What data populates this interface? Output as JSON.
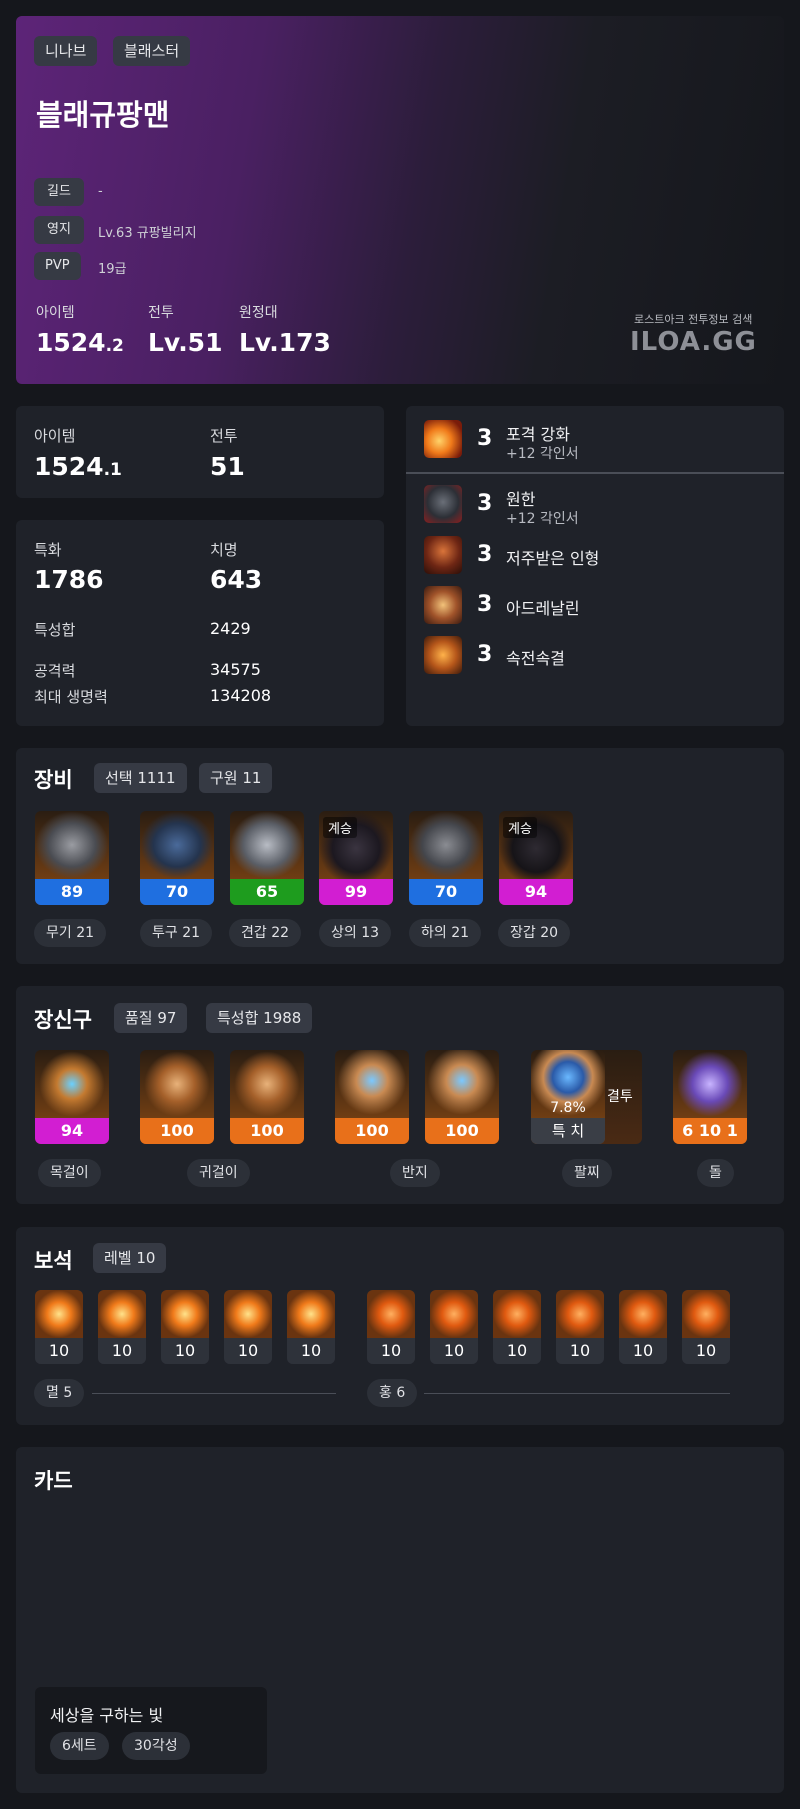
{
  "profile": {
    "server": "니나브",
    "class": "블래스터",
    "name": "블래규팡맨",
    "guild_label": "길드",
    "guild_value": "-",
    "estate_label": "영지",
    "estate_value": "Lv.63 규팡빌리지",
    "pvp_label": "PVP",
    "pvp_value": "19급",
    "item_label": "아이템",
    "item_main": "1524",
    "item_decimal": ".2",
    "combat_label": "전투",
    "combat_value": "Lv.51",
    "expedition_label": "원정대",
    "expedition_value": "Lv.173",
    "brand_caption": "로스트아크 전투정보 검색",
    "brand_logo": "ILOA.GG"
  },
  "levels": {
    "item_label": "아이템",
    "item_main": "1524",
    "item_decimal": ".1",
    "combat_label": "전투",
    "combat_value": "51"
  },
  "stats": {
    "spec_label": "특화",
    "spec_value": "1786",
    "crit_label": "치명",
    "crit_value": "643",
    "sum_label": "특성합",
    "sum_value": "2429",
    "atk_label": "공격력",
    "atk_value": "34575",
    "hp_label": "최대 생명력",
    "hp_value": "134208"
  },
  "engravings": [
    {
      "level": "3",
      "name": "포격 강화",
      "sub": "+12 각인서",
      "icon": "barrage-engraving-icon"
    },
    {
      "level": "3",
      "name": "원한",
      "sub": "+12 각인서",
      "icon": "grudge-engraving-icon"
    },
    {
      "level": "3",
      "name": "저주받은 인형",
      "sub": "",
      "icon": "cursed-doll-engraving-icon"
    },
    {
      "level": "3",
      "name": "아드레날린",
      "sub": "",
      "icon": "adrenaline-engraving-icon"
    },
    {
      "level": "3",
      "name": "속전속결",
      "sub": "",
      "icon": "spirit-absorption-engraving-icon"
    }
  ],
  "equipment": {
    "title": "장비",
    "chip_select": "선택 1111",
    "chip_salvation": "구원 11",
    "items": [
      {
        "quality": "89",
        "label": "무기 21",
        "succession": "",
        "quality_color": "#1f6fe0",
        "icon": "weapon-icon"
      },
      {
        "quality": "70",
        "label": "투구 21",
        "succession": "",
        "quality_color": "#1f6fe0",
        "icon": "helmet-icon"
      },
      {
        "quality": "65",
        "label": "견갑 22",
        "succession": "",
        "quality_color": "#1e9c1e",
        "icon": "shoulder-icon"
      },
      {
        "quality": "99",
        "label": "상의 13",
        "succession": "계승",
        "quality_color": "#d21ed2",
        "icon": "chest-icon"
      },
      {
        "quality": "70",
        "label": "하의 21",
        "succession": "",
        "quality_color": "#1f6fe0",
        "icon": "pants-icon"
      },
      {
        "quality": "94",
        "label": "장갑 20",
        "succession": "계승",
        "quality_color": "#d21ed2",
        "icon": "gloves-icon"
      }
    ]
  },
  "accessories": {
    "title": "장신구",
    "chip_quality": "품질 97",
    "chip_stats": "특성합 1988",
    "necklace": {
      "quality": "94",
      "label": "목걸이",
      "color": "#d21ed2"
    },
    "earrings": {
      "q1": "100",
      "q2": "100",
      "label": "귀걸이",
      "color": "#e8701a"
    },
    "rings": {
      "q1": "100",
      "q2": "100",
      "label": "반지",
      "color": "#e8701a"
    },
    "bracelet": {
      "percent": "7.8%",
      "stats": "특 치",
      "side": "결투",
      "label": "팔찌"
    },
    "stone": {
      "value": "6 10 1",
      "label": "돌",
      "color": "#e8701a"
    }
  },
  "gems": {
    "title": "보석",
    "chip_level": "레벨 10",
    "damage_gems": [
      "10",
      "10",
      "10",
      "10",
      "10"
    ],
    "cooldown_gems": [
      "10",
      "10",
      "10",
      "10",
      "10",
      "10"
    ],
    "damage_label": "멸 5",
    "cooldown_label": "홍 6"
  },
  "cards": {
    "title": "카드",
    "set_name": "세상을 구하는 빛",
    "set_count": "6세트",
    "awaken": "30각성"
  }
}
